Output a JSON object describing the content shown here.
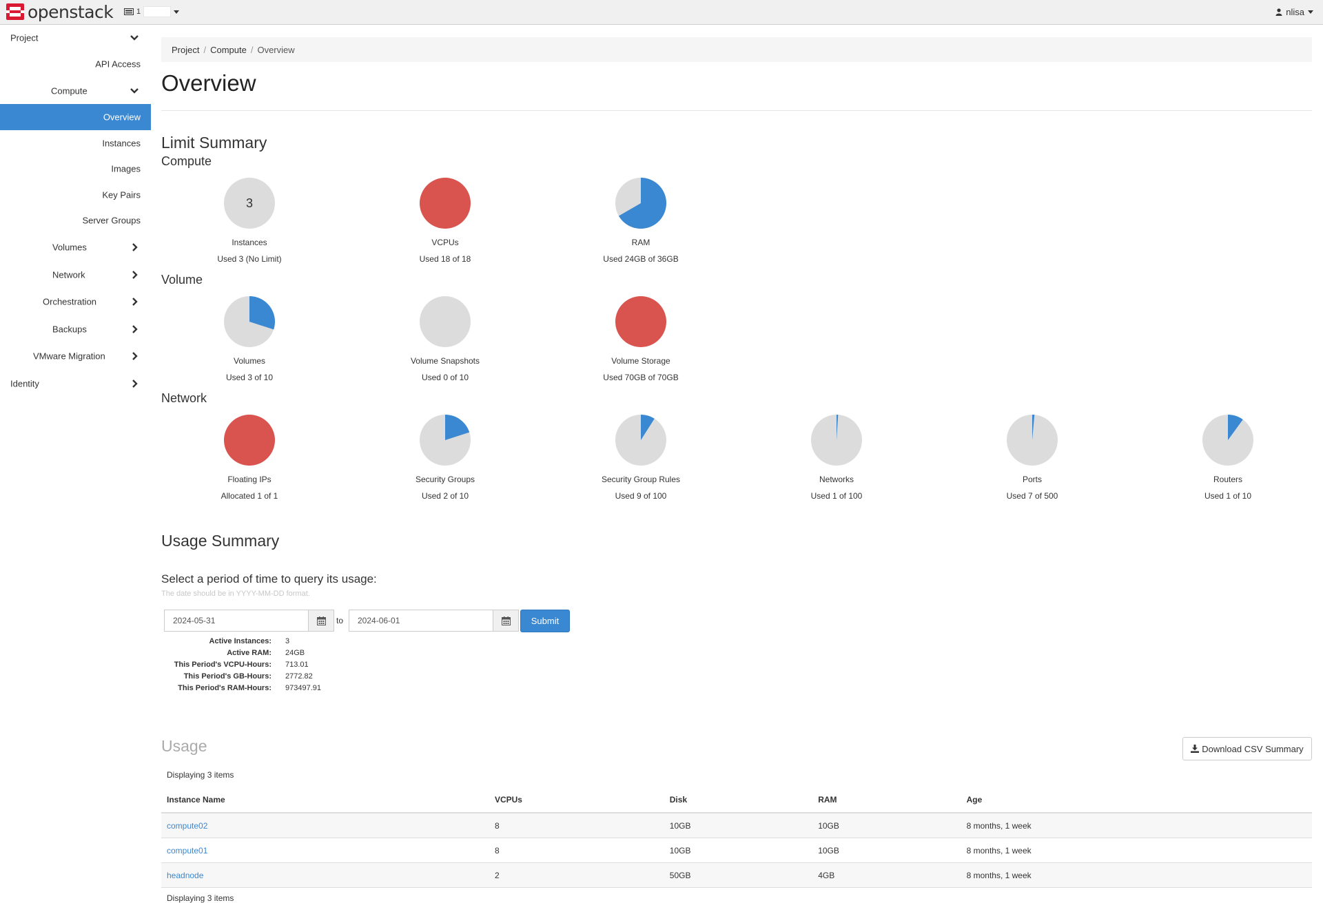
{
  "brand": {
    "name": "openstack"
  },
  "topbar": {
    "project_label": "1",
    "user": "nlisa"
  },
  "sidebar": {
    "items": [
      {
        "label": "Project",
        "chevron": "down"
      },
      {
        "label": "API Access",
        "chevron": ""
      },
      {
        "label": "Compute",
        "chevron": "down"
      },
      {
        "label": "Overview",
        "chevron": "",
        "active": true
      },
      {
        "label": "Instances",
        "chevron": ""
      },
      {
        "label": "Images",
        "chevron": ""
      },
      {
        "label": "Key Pairs",
        "chevron": ""
      },
      {
        "label": "Server Groups",
        "chevron": ""
      },
      {
        "label": "Volumes",
        "chevron": "right"
      },
      {
        "label": "Network",
        "chevron": "right"
      },
      {
        "label": "Orchestration",
        "chevron": "right"
      },
      {
        "label": "Backups",
        "chevron": "right"
      },
      {
        "label": "VMware Migration",
        "chevron": "right"
      },
      {
        "label": "Identity",
        "chevron": "right"
      }
    ]
  },
  "breadcrumb": [
    "Project",
    "Compute",
    "Overview"
  ],
  "page_title": "Overview",
  "limit_summary": {
    "title": "Limit Summary",
    "groups": [
      {
        "title": "Compute",
        "charts": [
          {
            "name": "Instances",
            "used_text": "Used 3 (No Limit)",
            "fraction": 0,
            "center_text": "3"
          },
          {
            "name": "VCPUs",
            "used_text": "Used 18 of 18",
            "fraction": 1
          },
          {
            "name": "RAM",
            "used_text": "Used 24GB of 36GB",
            "fraction": 0.6667
          }
        ]
      },
      {
        "title": "Volume",
        "charts": [
          {
            "name": "Volumes",
            "used_text": "Used 3 of 10",
            "fraction": 0.3
          },
          {
            "name": "Volume Snapshots",
            "used_text": "Used 0 of 10",
            "fraction": 0
          },
          {
            "name": "Volume Storage",
            "used_text": "Used 70GB of 70GB",
            "fraction": 1
          }
        ]
      },
      {
        "title": "Network",
        "charts": [
          {
            "name": "Floating IPs",
            "used_text": "Allocated 1 of 1",
            "fraction": 1
          },
          {
            "name": "Security Groups",
            "used_text": "Used 2 of 10",
            "fraction": 0.2
          },
          {
            "name": "Security Group Rules",
            "used_text": "Used 9 of 100",
            "fraction": 0.09
          },
          {
            "name": "Networks",
            "used_text": "Used 1 of 100",
            "fraction": 0.01
          },
          {
            "name": "Ports",
            "used_text": "Used 7 of 500",
            "fraction": 0.014
          },
          {
            "name": "Routers",
            "used_text": "Used 1 of 10",
            "fraction": 0.1
          }
        ]
      }
    ]
  },
  "colors": {
    "used": "#3a87d2",
    "full": "#d9534f",
    "free": "#dcdcdc",
    "accent": "#3a87d2"
  },
  "usage_summary": {
    "title": "Usage Summary",
    "prompt": "Select a period of time to query its usage:",
    "help": "The date should be in YYYY-MM-DD format.",
    "start": "2024-05-31",
    "to_label": "to",
    "end": "2024-06-01",
    "submit": "Submit",
    "stats": [
      {
        "k": "Active Instances:",
        "v": "3"
      },
      {
        "k": "Active RAM:",
        "v": "24GB"
      },
      {
        "k": "This Period's VCPU-Hours:",
        "v": "713.01"
      },
      {
        "k": "This Period's GB-Hours:",
        "v": "2772.82"
      },
      {
        "k": "This Period's RAM-Hours:",
        "v": "973497.91"
      }
    ]
  },
  "usage": {
    "title": "Usage",
    "download": "Download CSV Summary",
    "displaying": "Displaying 3 items",
    "columns": [
      "Instance Name",
      "VCPUs",
      "Disk",
      "RAM",
      "Age"
    ],
    "rows": [
      [
        "compute02",
        "8",
        "10GB",
        "10GB",
        "8 months, 1 week"
      ],
      [
        "compute01",
        "8",
        "10GB",
        "10GB",
        "8 months, 1 week"
      ],
      [
        "headnode",
        "2",
        "50GB",
        "4GB",
        "8 months, 1 week"
      ]
    ]
  }
}
